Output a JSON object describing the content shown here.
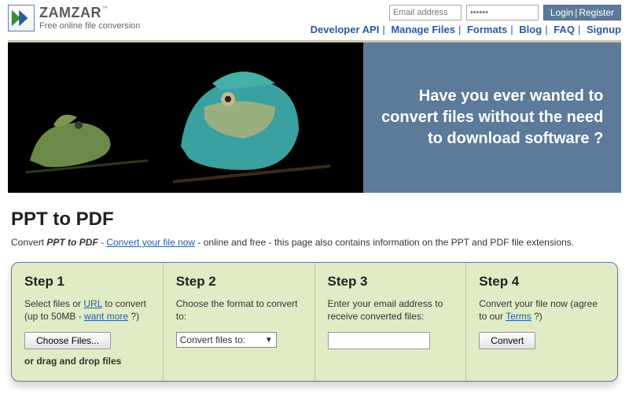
{
  "brand": {
    "name": "ZAMZAR",
    "tm": "™",
    "tagline": "Free online file conversion"
  },
  "login": {
    "email_ph": "Email address",
    "password_ph": "••••••",
    "login": "Login",
    "register": "Register"
  },
  "nav": [
    "Developer API",
    "Manage Files",
    "Formats",
    "Blog",
    "FAQ",
    "Signup"
  ],
  "hero": {
    "line1": "Have you ever wanted to",
    "line2": "convert files without the need",
    "line3": "to download software ?"
  },
  "page": {
    "title": "PPT to PDF",
    "sub_pre": "Convert ",
    "sub_bold": "PPT to PDF",
    "sub_dash": " - ",
    "sub_link": "Convert your file now",
    "sub_post": " - online and free - this page also contains information on the PPT and PDF file extensions."
  },
  "steps": {
    "s1": {
      "title": "Step 1",
      "text_pre": "Select files or ",
      "url": "URL",
      "text_mid": " to convert (up to 50MB - ",
      "want": "want more",
      "text_post": " ?)",
      "button": "Choose Files...",
      "drag": "or drag and drop files"
    },
    "s2": {
      "title": "Step 2",
      "text": "Choose the format to convert to:",
      "select": "Convert files to:"
    },
    "s3": {
      "title": "Step 3",
      "text": "Enter your email address to receive converted files:"
    },
    "s4": {
      "title": "Step 4",
      "text_pre": "Convert your file now (agree to our ",
      "terms": "Terms",
      "text_post": " ?)",
      "button": "Convert"
    }
  }
}
